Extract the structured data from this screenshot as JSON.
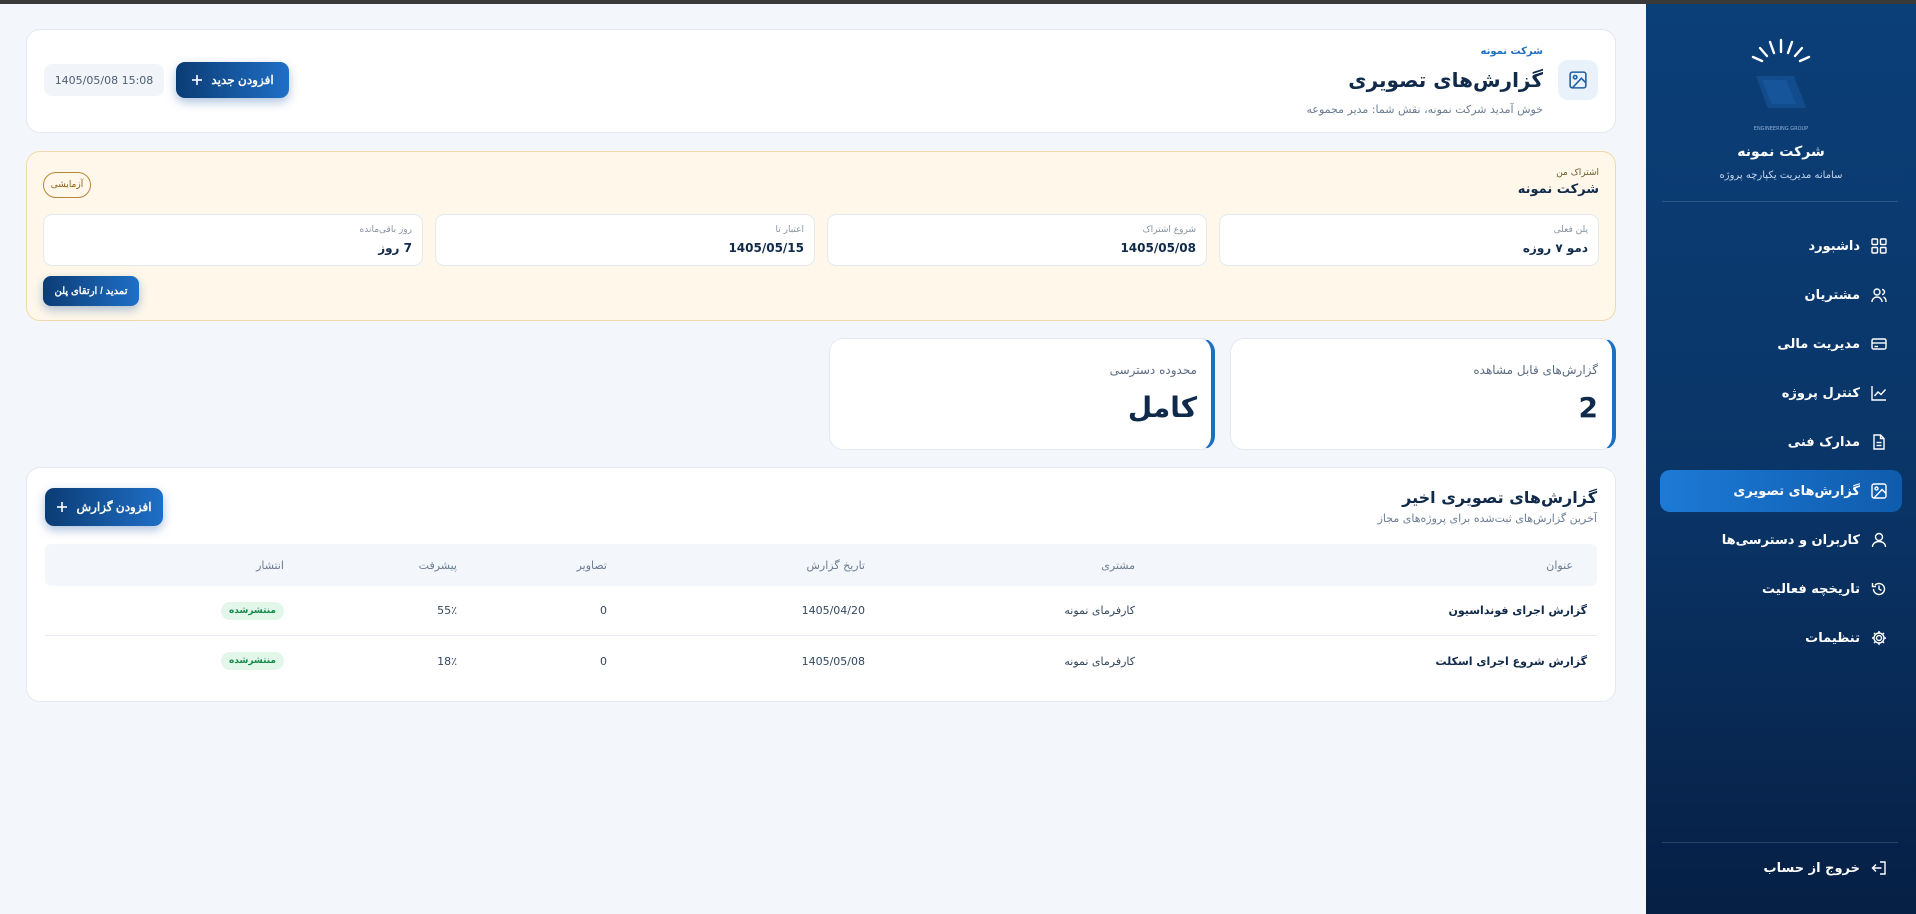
{
  "sidebar": {
    "brand_name": "شرکت نمونه",
    "brand_sub": "سامانه مدیریت یکپارچه پروژه",
    "logo_text": "ENGINEERING GROUP",
    "items": [
      {
        "label": "داشبورد",
        "icon": "grid-icon"
      },
      {
        "label": "مشتریان",
        "icon": "users-icon"
      },
      {
        "label": "مدیریت مالی",
        "icon": "card-icon"
      },
      {
        "label": "کنترل پروژه",
        "icon": "chart-line-icon"
      },
      {
        "label": "مدارک فنی",
        "icon": "document-icon"
      },
      {
        "label": "گزارش‌های تصویری",
        "icon": "image-icon",
        "active": true
      },
      {
        "label": "کاربران و دسترسی‌ها",
        "icon": "user-icon"
      },
      {
        "label": "تاریخچه فعالیت",
        "icon": "history-icon"
      },
      {
        "label": "تنظیمات",
        "icon": "gear-icon"
      }
    ],
    "logout": "خروج از حساب"
  },
  "header": {
    "company": "شرکت نمونه",
    "title": "گزارش‌های تصویری",
    "welcome": "خوش آمدید شرکت نمونه، نقش شما: مدیر مجموعه",
    "add_new": "افزودن جدید",
    "datetime": "1405/05/08 15:08"
  },
  "subscription": {
    "label": "اشتراک من",
    "name": "شرکت نمونه",
    "badge": "آزمایشی",
    "boxes": [
      {
        "label": "پلن فعلی",
        "value": "دمو ۷ روزه"
      },
      {
        "label": "شروع اشتراک",
        "value": "1405/05/08"
      },
      {
        "label": "اعتبار تا",
        "value": "1405/05/15"
      },
      {
        "label": "روز باقی‌مانده",
        "value": "7 روز"
      }
    ],
    "renew": "تمدید / ارتقای پلن"
  },
  "stats": [
    {
      "label": "گزارش‌های قابل مشاهده",
      "value": "2"
    },
    {
      "label": "محدوده دسترسی",
      "value": "کامل"
    }
  ],
  "reports": {
    "title": "گزارش‌های تصویری اخیر",
    "subtitle": "آخرین گزارش‌های ثبت‌شده برای پروژه‌های مجاز",
    "add_report": "افزودن گزارش",
    "columns": {
      "title": "عنوان",
      "client": "مشتری",
      "date": "تاریخ گزارش",
      "images": "تصاویر",
      "progress": "پیشرفت",
      "publish": "انتشار"
    },
    "rows": [
      {
        "title": "گزارش اجرای فونداسیون",
        "client": "کارفرمای نمونه",
        "date": "1405/04/20",
        "images": "0",
        "progress": "55٪",
        "publish": "منتشرشده"
      },
      {
        "title": "گزارش شروع اجرای اسکلت",
        "client": "کارفرمای نمونه",
        "date": "1405/05/08",
        "images": "0",
        "progress": "18٪",
        "publish": "منتشرشده"
      }
    ]
  }
}
